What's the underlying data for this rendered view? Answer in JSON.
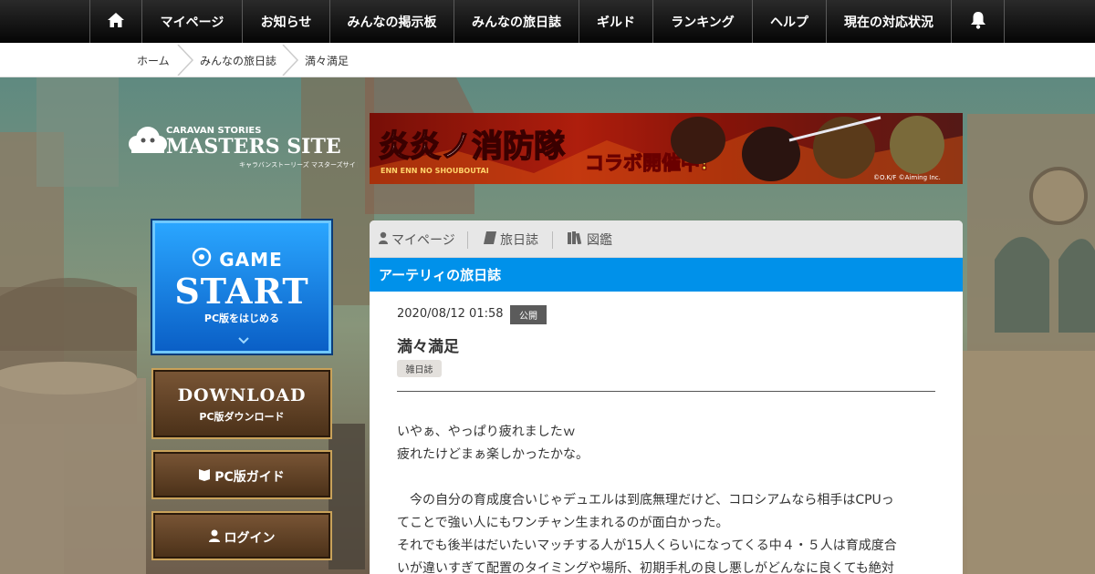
{
  "nav": {
    "home_icon": "home-icon",
    "items": [
      "マイページ",
      "お知らせ",
      "みんなの掲示板",
      "みんなの旅日誌",
      "ギルド",
      "ランキング",
      "ヘルプ",
      "現在の対応状況"
    ],
    "bell_icon": "bell-icon"
  },
  "breadcrumb": [
    "ホーム",
    "みんなの旅日誌",
    "満々満足"
  ],
  "logo": {
    "top": "CARAVAN STORIES",
    "main": "MASTERS SITE",
    "sub": "キャラバンストーリーズ マスターズサイト"
  },
  "banner": {
    "title": "炎炎ノ消防隊",
    "romaji": "ENN ENN NO SHOUBOUTAI",
    "collab": "コラボ開催中!",
    "copyright": "©O.K/F ©Aiming Inc."
  },
  "side": {
    "game_start_small": "GAME",
    "game_start_big": "START",
    "game_start_sub": "PC版をはじめる",
    "download_main": "DOWNLOAD",
    "download_sub": "PC版ダウンロード",
    "guide": "PC版ガイド",
    "login": "ログイン"
  },
  "panel": {
    "tabs": [
      {
        "label": "マイページ",
        "icon": "user-icon"
      },
      {
        "label": "旅日誌",
        "icon": "book-icon"
      },
      {
        "label": "図鑑",
        "icon": "library-icon"
      }
    ],
    "heading": "アーテリィの旅日誌",
    "date": "2020/08/12 01:58",
    "status": "公開",
    "title": "満々満足",
    "category": "雑日誌",
    "body": [
      "いやぁ、やっぱり疲れましたｗ",
      "疲れたけどまぁ楽しかったかな。",
      "",
      "　今の自分の育成度合いじゃデュエルは到底無理だけど、コロシアムなら相手はCPUっ",
      "てことで強い人にもワンチャン生まれるのが面白かった。",
      "それでも後半はだいたいマッチする人が15人くらいになってくる中４・５人は育成度合",
      "いが違いすぎて配置のタイミングや場所、初期手札の良し悪しがどんなに良くても絶対"
    ]
  },
  "colors": {
    "nav_bg": "#111111",
    "accent_blue": "#0091ea",
    "status_badge": "#5b5b5b"
  }
}
